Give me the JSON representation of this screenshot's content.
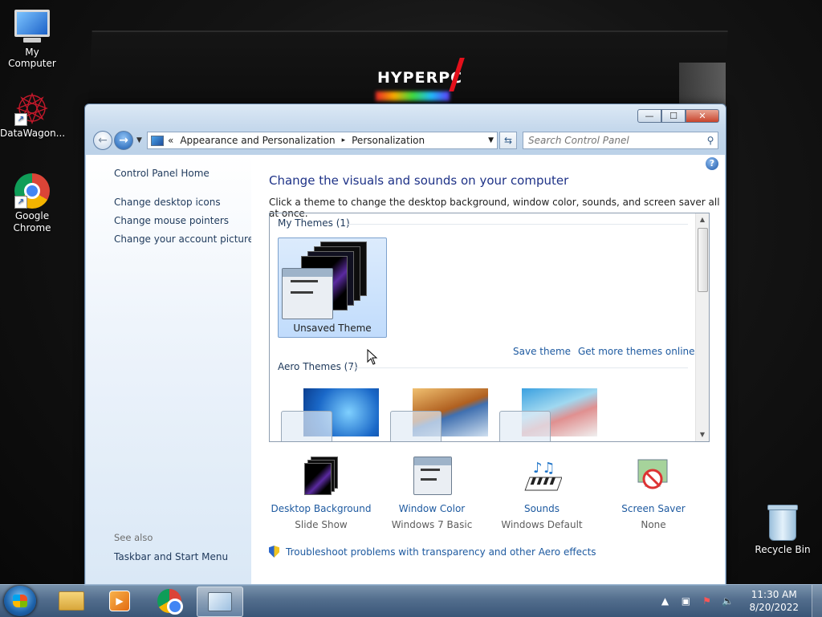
{
  "desktop": {
    "icons": [
      {
        "label": "My Computer"
      },
      {
        "label": "DataWagon..."
      },
      {
        "label": "Google\nChrome"
      },
      {
        "label": "Recycle Bin"
      }
    ],
    "wallpaper_logo": "HYPERPC"
  },
  "window": {
    "buttons": {
      "minimize": "—",
      "maximize": "☐",
      "close": "✕"
    },
    "address": {
      "overflow": "«",
      "segments": [
        "Appearance and Personalization",
        "Personalization"
      ],
      "separator": "▸"
    },
    "search": {
      "placeholder": "Search Control Panel"
    },
    "sidebar": {
      "home": "Control Panel Home",
      "links": [
        "Change desktop icons",
        "Change mouse pointers",
        "Change your account picture"
      ],
      "see_also": "See also",
      "see_also_links": [
        "Taskbar and Start Menu"
      ]
    },
    "main": {
      "help": "?",
      "title": "Change the visuals and sounds on your computer",
      "subtitle": "Click a theme to change the desktop background, window color, sounds, and screen saver all at once.",
      "my_themes": "My Themes (1)",
      "unsaved_theme": "Unsaved Theme",
      "save_theme": "Save theme",
      "get_more": "Get more themes online",
      "aero_themes": "Aero Themes (7)"
    },
    "bottom": [
      {
        "label": "Desktop Background",
        "value": "Slide Show"
      },
      {
        "label": "Window Color",
        "value": "Windows 7 Basic"
      },
      {
        "label": "Sounds",
        "value": "Windows Default"
      },
      {
        "label": "Screen Saver",
        "value": "None"
      }
    ],
    "troubleshoot": "Troubleshoot problems with transparency and other Aero effects"
  },
  "taskbar": {
    "time": "11:30 AM",
    "date": "8/20/2022"
  },
  "colors": {
    "link": "#1e5aa0",
    "title": "#1e3287",
    "taskbar": "#4b6f96"
  }
}
